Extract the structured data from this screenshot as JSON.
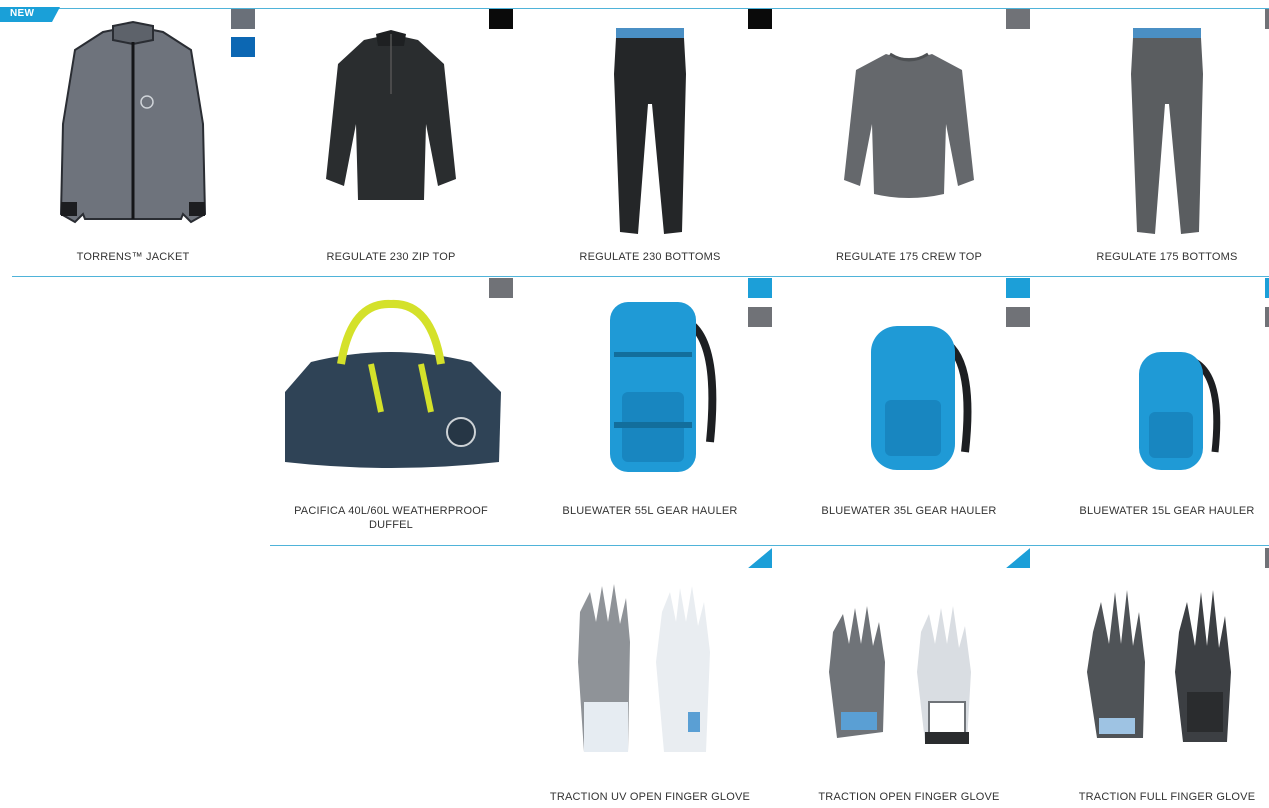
{
  "badge": {
    "text": "NEW"
  },
  "colors": {
    "rule": "#4fb3d9",
    "badge": "#1aa0d8",
    "swatch_gray": "#707277",
    "swatch_slate": "#6a7079",
    "swatch_blue": "#0c67b3",
    "swatch_black": "#0a0a0a",
    "swatch_cyan": "#1c9fd8",
    "swatch_white_cyan": "#1c9fd8"
  },
  "rows": [
    {
      "products": [
        {
          "name": "TORRENS™ JACKET",
          "image": "jacket-icon",
          "swatches": [
            "slate",
            "blue"
          ]
        },
        {
          "name": "REGULATE 230 ZIP TOP",
          "image": "zip-top-icon",
          "swatches": [
            "black"
          ]
        },
        {
          "name": "REGULATE 230 BOTTOMS",
          "image": "bottoms-icon",
          "swatches": [
            "black"
          ]
        },
        {
          "name": "REGULATE 175 CREW TOP",
          "image": "crew-top-icon",
          "swatches": [
            "gray"
          ]
        },
        {
          "name": "REGULATE 175 BOTTOMS",
          "image": "bottoms-icon",
          "swatches": [
            "gray-thin"
          ]
        }
      ]
    },
    {
      "products": [
        {
          "name": "PACIFICA 40L/60L WEATHERPROOF DUFFEL",
          "image": "duffel-icon",
          "swatches": [
            "gray"
          ]
        },
        {
          "name": "BLUEWATER 55L GEAR HAULER",
          "image": "backpack-icon",
          "swatches": [
            "cyan",
            "gray"
          ]
        },
        {
          "name": "BLUEWATER 35L GEAR HAULER",
          "image": "backpack-icon",
          "swatches": [
            "cyan",
            "gray"
          ]
        },
        {
          "name": "BLUEWATER 15L GEAR HAULER",
          "image": "backpack-icon",
          "swatches": [
            "cyan-thin",
            "gray-thin"
          ]
        }
      ]
    },
    {
      "products": [
        {
          "name": "TRACTION UV OPEN FINGER GLOVE",
          "image": "glove-icon",
          "swatches": [
            "white-cyan"
          ]
        },
        {
          "name": "TRACTION OPEN FINGER GLOVE",
          "image": "glove-icon",
          "swatches": [
            "white-cyan"
          ]
        },
        {
          "name": "TRACTION FULL FINGER GLOVE",
          "image": "glove-icon",
          "swatches": [
            "gray-thin"
          ]
        }
      ]
    }
  ]
}
